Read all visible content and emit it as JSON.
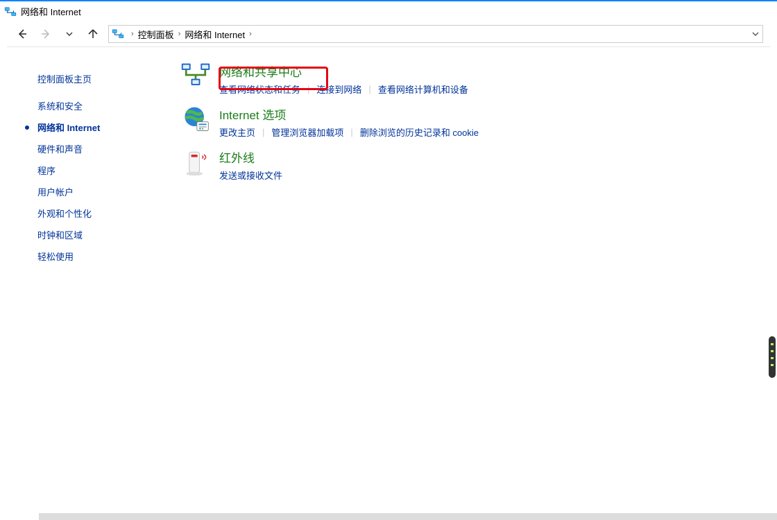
{
  "title": "网络和 Internet",
  "breadcrumb": {
    "items": [
      "控制面板",
      "网络和 Internet"
    ]
  },
  "sidebar": {
    "items": [
      {
        "label": "控制面板主页",
        "active": false
      },
      {
        "label": "系统和安全",
        "active": false
      },
      {
        "label": "网络和 Internet",
        "active": true
      },
      {
        "label": "硬件和声音",
        "active": false
      },
      {
        "label": "程序",
        "active": false
      },
      {
        "label": "用户帐户",
        "active": false
      },
      {
        "label": "外观和个性化",
        "active": false
      },
      {
        "label": "时钟和区域",
        "active": false
      },
      {
        "label": "轻松使用",
        "active": false
      }
    ]
  },
  "categories": [
    {
      "title": "网络和共享中心",
      "links": [
        "查看网络状态和任务",
        "连接到网络",
        "查看网络计算机和设备"
      ],
      "highlighted": true
    },
    {
      "title": "Internet 选项",
      "links": [
        "更改主页",
        "管理浏览器加载项",
        "删除浏览的历史记录和 cookie"
      ]
    },
    {
      "title": "红外线",
      "links": [
        "发送或接收文件"
      ]
    }
  ],
  "colors": {
    "link": "#003399",
    "heading": "#1a7d1a",
    "highlight": "#e30613",
    "accent": "#0a84ff"
  }
}
